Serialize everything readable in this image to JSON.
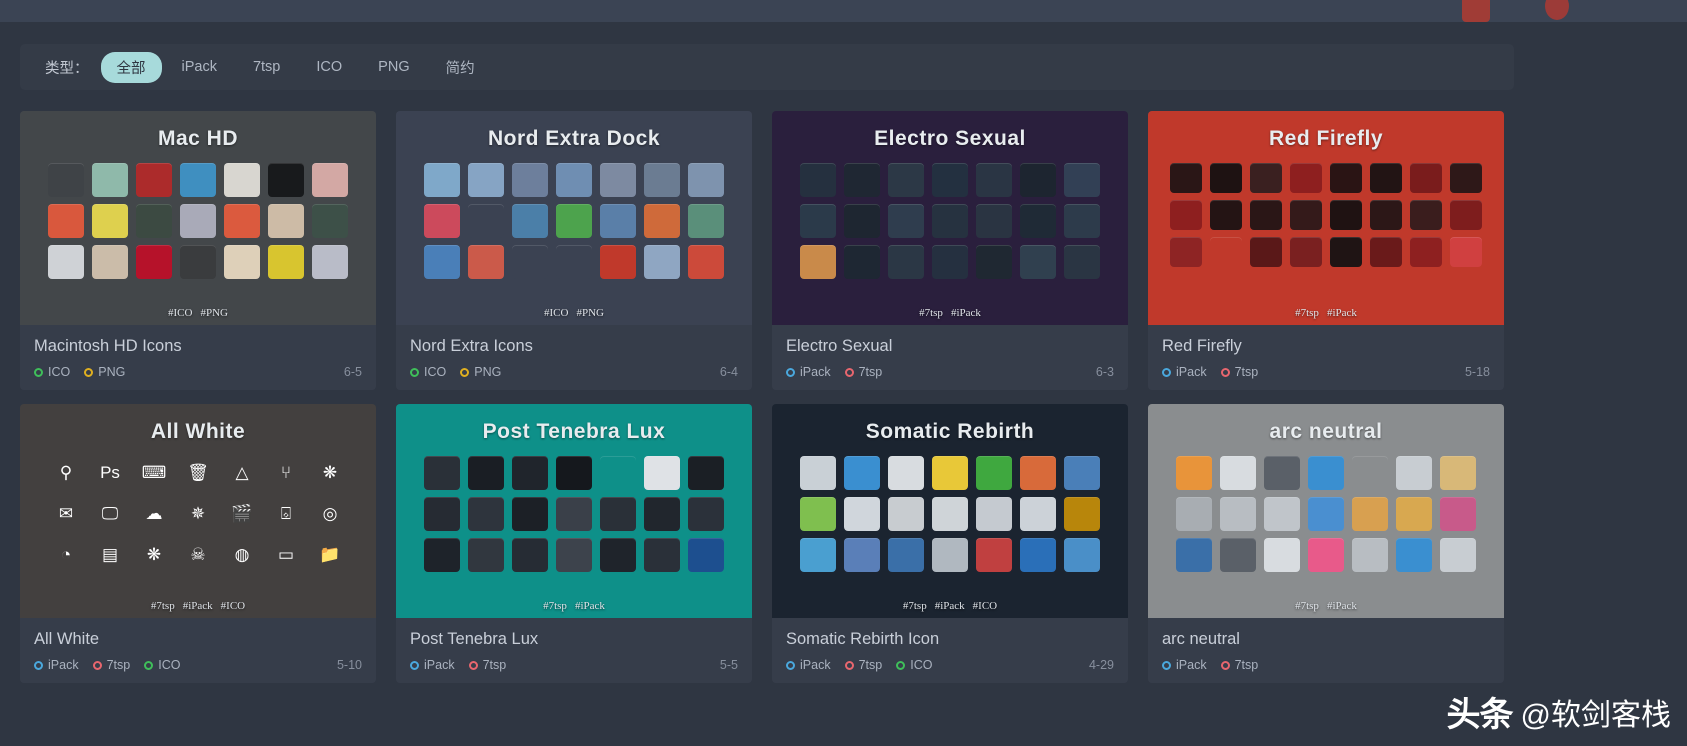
{
  "filter": {
    "label": "类型：",
    "chips": [
      {
        "label": "全部",
        "active": true
      },
      {
        "label": "iPack",
        "active": false
      },
      {
        "label": "7tsp",
        "active": false
      },
      {
        "label": "ICO",
        "active": false
      },
      {
        "label": "PNG",
        "active": false
      },
      {
        "label": "简约",
        "active": false
      }
    ]
  },
  "tag_colors": {
    "iPack": "#4aa8dd",
    "7tsp": "#e8666e",
    "ICO": "#3fbf5a",
    "PNG": "#e0b020"
  },
  "cards": [
    {
      "preview_title": "Mac HD",
      "title": "Macintosh HD Icons",
      "tags": [
        "ICO",
        "PNG"
      ],
      "date": "6-5",
      "hashtags": [
        "#ICO",
        "#PNG"
      ],
      "bg": "#43474a",
      "cols": 7,
      "icons": [
        "#3f4347",
        "#8fb9aa",
        "#ac2b2b",
        "#3f8fc0",
        "#d8d6d0",
        "#181a1c",
        "#d3a8a4",
        "#d9583d",
        "#ded04e",
        "#3c4a42",
        "#a9aab8",
        "#db5a3e",
        "#cdbba6",
        "#3d5048",
        "#cfd2d6",
        "#cbbca9",
        "#b6122a",
        "#3a3c3e",
        "#ded0b9",
        "#d8c52f",
        "#b9bcc8"
      ]
    },
    {
      "preview_title": "Nord Extra Dock",
      "title": "Nord Extra Icons",
      "tags": [
        "ICO",
        "PNG"
      ],
      "date": "6-4",
      "hashtags": [
        "#ICO",
        "#PNG"
      ],
      "bg": "#3b4252",
      "cols": 7,
      "icons": [
        "#7fa8c9",
        "#86a4c4",
        "#6d7f9c",
        "#6f8eb2",
        "#7d8aa1",
        "#6b7c92",
        "#7e93ae",
        "#cc4a5c",
        "#3b4252",
        "#4b7fa8",
        "#4da34d",
        "#5a7fa8",
        "#cf6a3a",
        "#5a8f7a",
        "#4a7fb8",
        "#cb5a4a",
        "#3b4252",
        "#3b4252",
        "#c0392b",
        "#8fa6c2",
        "#cc4a3a"
      ]
    },
    {
      "preview_title": "Electro Sexual",
      "title": "Electro Sexual",
      "tags": [
        "iPack",
        "7tsp"
      ],
      "date": "6-3",
      "hashtags": [
        "#7tsp",
        "#iPack"
      ],
      "bg": "#2a1f3d",
      "cols": 7,
      "icons": [
        "#25303f",
        "#1f2733",
        "#2c3846",
        "#233040",
        "#2a3544",
        "#1d2530",
        "#324055",
        "#2b3a4a",
        "#1e2631",
        "#2f3d4e",
        "#263240",
        "#2a3442",
        "#1f2a36",
        "#2d3b4b",
        "#c98a4a",
        "#1e2733",
        "#2b3745",
        "#253040",
        "#1f2832",
        "#30404f",
        "#2a3543"
      ]
    },
    {
      "preview_title": "Red Firefly",
      "title": "Red Firefly",
      "tags": [
        "iPack",
        "7tsp"
      ],
      "date": "5-18",
      "hashtags": [
        "#7tsp",
        "#iPack"
      ],
      "bg": "#c0392b",
      "cols": 8,
      "icons": [
        "#2a1616",
        "#1e1212",
        "#3a2020",
        "#8e1f1f",
        "#2a1414",
        "#221414",
        "#7a1c1c",
        "#2e1818",
        "#8e1f1f",
        "#241414",
        "#2a1616",
        "#341a1a",
        "#1f1212",
        "#2c1717",
        "#3a1d1d",
        "#7e1d1d",
        "#8e2424",
        "#26 1414",
        "#5a1818",
        "#7a2020",
        "#1f1414",
        "#6a1a1a",
        "#8e2020",
        "#d04040"
      ]
    },
    {
      "preview_title": "All White",
      "title": "All White",
      "tags": [
        "iPack",
        "7tsp",
        "ICO"
      ],
      "date": "5-10",
      "hashtags": [
        "#7tsp",
        "#iPack",
        "#ICO"
      ],
      "bg": "#43403f",
      "cols": 7,
      "icons": [
        "#43403f",
        "#43403f",
        "#43403f",
        "#43403f",
        "#43403f",
        "#43403f",
        "#43403f",
        "#43403f",
        "#43403f",
        "#43403f",
        "#43403f",
        "#43403f",
        "#43403f",
        "#43403f",
        "#43403f",
        "#43403f",
        "#43403f",
        "#43403f",
        "#43403f",
        "#43403f",
        "#43403f"
      ],
      "glyphs": [
        "⚲",
        "Ps",
        "⌨",
        "🗑",
        "△",
        "⑂",
        "❋",
        "✉",
        "🖵",
        "☁",
        "✵",
        "🎬",
        "⌺",
        "◎",
        "◔",
        "▤",
        "❋",
        "☠",
        "◍",
        "▭",
        "📁"
      ]
    },
    {
      "preview_title": "Post Tenebra Lux",
      "title": "Post Tenebra Lux",
      "tags": [
        "iPack",
        "7tsp"
      ],
      "date": "5-5",
      "hashtags": [
        "#7tsp",
        "#iPack"
      ],
      "bg": "#0e9089",
      "cols": 7,
      "icons": [
        "#2a3038",
        "#1a1e24",
        "#20252c",
        "#15181d",
        "#2c3views",
        "#dfe2e6",
        "#1b1f25",
        "#262b33",
        "#2e343d",
        "#1c2026",
        "#3a4049",
        "#2a3038",
        "#21262d",
        "#2b313a",
        "#1e232a",
        "#31373f",
        "#262c34",
        "#3d434c",
        "#1f242b",
        "#2a3039",
        "#1d4f8f"
      ]
    },
    {
      "preview_title": "Somatic Rebirth",
      "title": "Somatic Rebirth Icon",
      "tags": [
        "iPack",
        "7tsp",
        "ICO"
      ],
      "date": "4-29",
      "hashtags": [
        "#7tsp",
        "#iPack",
        "#ICO"
      ],
      "bg": "#1b2430",
      "cols": 7,
      "icons": [
        "#c9d0d6",
        "#3a8fd0",
        "#d8dce0",
        "#e8c838",
        "#3fa83f",
        "#d86a3a",
        "#4a7fb8",
        "#7fbf4f",
        "#d0d6dc",
        "#c8ccd0",
        "#cfd4d8",
        "#c5cad0",
        "#ccd2d8",
        "#b8860b",
        "#4a9fd0",
        "#5a7fb8",
        "#3a6fa8",
        "#b0b8c0",
        "#c04040",
        "#2a6fb8",
        "#4a8fc8"
      ]
    },
    {
      "preview_title": "arc neutral",
      "title": "arc neutral",
      "tags": [
        "iPack",
        "7tsp"
      ],
      "date": "",
      "hashtags": [
        "#7tsp",
        "#iPack"
      ],
      "bg": "#8a8d8f",
      "cols": 7,
      "icons": [
        "#e8943a",
        "#d8dce0",
        "#5a6068",
        "#3a8fd0",
        "#8a8d8f",
        "#c8cdd2",
        "#d8b878",
        "#a8adb2",
        "#b8bdc2",
        "#c0c5ca",
        "#4a8fd0",
        "#d8a050",
        "#d8a850",
        "#c85a8a",
        "#3a6fa8",
        "#5a6068",
        "#d8dce0",
        "#e85a8a",
        "#b8bdc2",
        "#3a8fd0",
        "#c8cdd2"
      ]
    }
  ],
  "watermark": {
    "logo": "头条",
    "text": "@软剑客栈"
  }
}
